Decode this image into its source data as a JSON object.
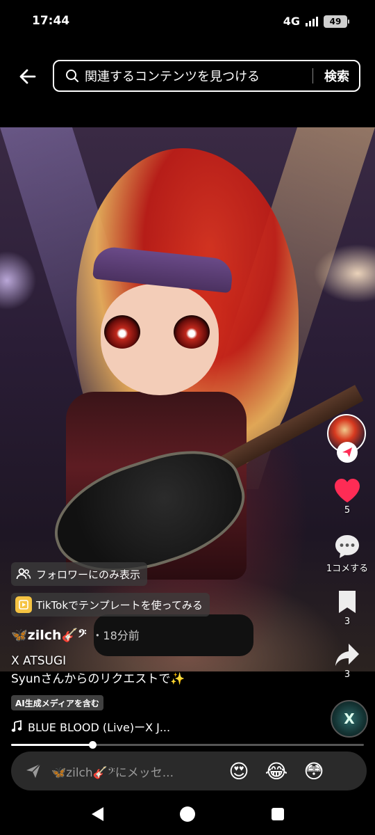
{
  "status_bar": {
    "time": "17:44",
    "network": "4G",
    "battery": "49"
  },
  "search": {
    "placeholder": "関連するコンテンツを見つける",
    "button_label": "検索"
  },
  "video": {
    "description": ""
  },
  "actions": {
    "like_count": "5",
    "comment_label": "1コメする",
    "bookmark_count": "3",
    "share_count": "3"
  },
  "overlay": {
    "followers_only_label": "フォロワーにのみ表示",
    "template_label": "TikTokでテンプレートを使ってみる",
    "username": "🦋zilch🎸𝄢",
    "time_ago": "・18分前",
    "caption_line1": "X ATSUGI",
    "caption_line2": "Syunさんからのリクエストで✨",
    "ai_label": "AI生成メディアを含む",
    "music_title": "BLUE BLOOD (Live)ーX J...",
    "music_disc_text": "X"
  },
  "progress": {
    "fraction": 0.23
  },
  "comment_bar": {
    "placeholder": "🦋zilch🎸𝄢にメッセ...",
    "emojis": [
      "😍",
      "😂",
      "😳"
    ]
  },
  "colors": {
    "like": "#fe2c55",
    "follow_badge_icon": "#fe2c55",
    "template_icon_bg": "#f5c342",
    "background": "#000000"
  },
  "icons": {
    "back": "arrow-left-icon",
    "search": "search-icon",
    "like": "heart-icon",
    "comment": "comment-icon",
    "bookmark": "bookmark-icon",
    "share": "share-icon",
    "music": "music-note-icon",
    "send": "send-icon"
  }
}
